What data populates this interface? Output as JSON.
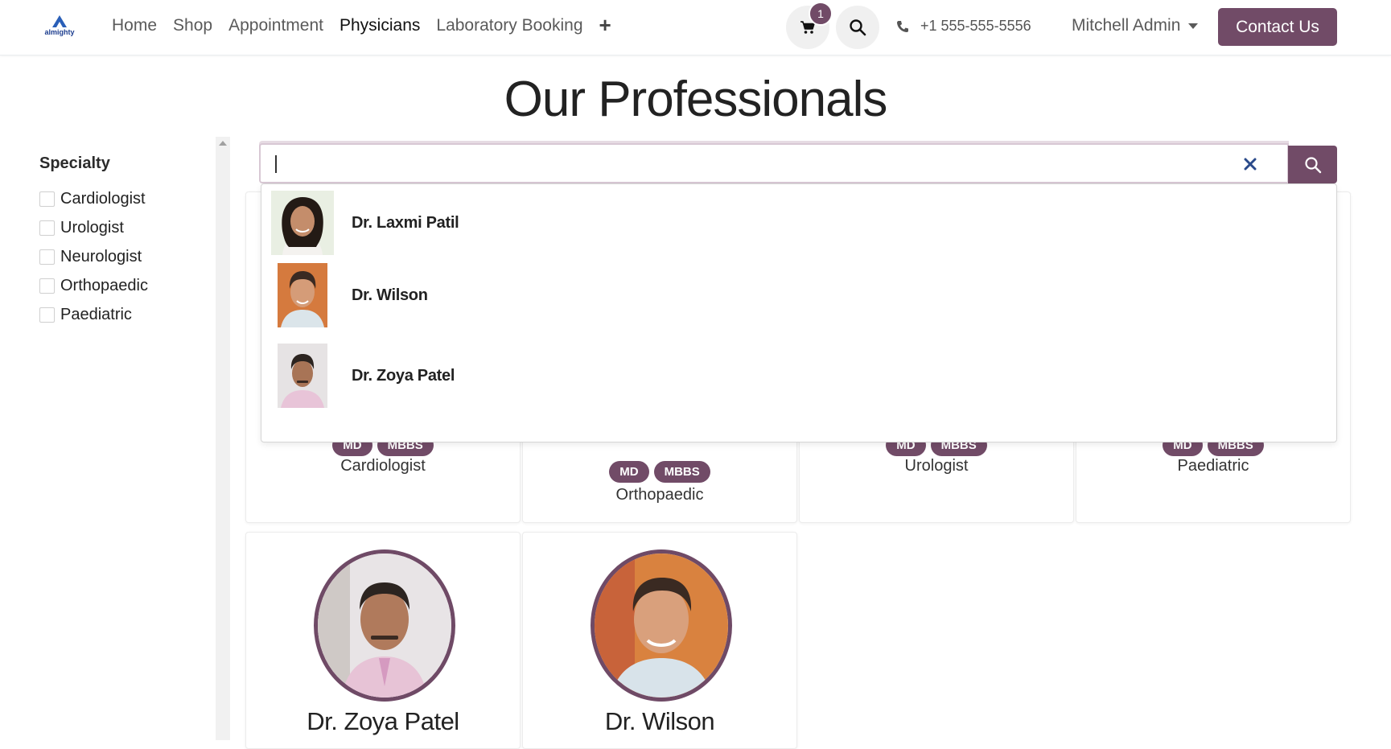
{
  "brand": {
    "logo_text": "almighty"
  },
  "nav": {
    "items": [
      "Home",
      "Shop",
      "Appointment",
      "Physicians",
      "Laboratory Booking"
    ],
    "active": "Physicians",
    "plus": "+"
  },
  "header": {
    "cart_count": "1",
    "phone": "+1 555-555-5556",
    "user": "Mitchell Admin",
    "contact_label": "Contact Us"
  },
  "page": {
    "title": "Our Professionals"
  },
  "sidebar": {
    "title": "Specialty",
    "filters": [
      "Cardiologist",
      "Urologist",
      "Neurologist",
      "Orthopaedic",
      "Paediatric"
    ]
  },
  "search": {
    "value": "",
    "clear_icon": "close-icon",
    "results": [
      "Dr. Laxmi Patil",
      "Dr. Wilson",
      "Dr. Zoya Patel"
    ]
  },
  "cards_row1": [
    {
      "degrees": [
        "MD",
        "MBBS"
      ],
      "specialty": "Cardiologist"
    },
    {
      "degrees": [
        "MD",
        "MBBS"
      ],
      "specialty": "Orthopaedic"
    },
    {
      "degrees": [
        "MD",
        "MBBS"
      ],
      "specialty": "Urologist"
    },
    {
      "degrees": [
        "MD",
        "MBBS"
      ],
      "specialty": "Paediatric"
    }
  ],
  "cards_row2": [
    {
      "name": "Dr. Zoya Patel"
    },
    {
      "name": "Dr. Wilson"
    }
  ],
  "colors": {
    "accent": "#714b67"
  }
}
